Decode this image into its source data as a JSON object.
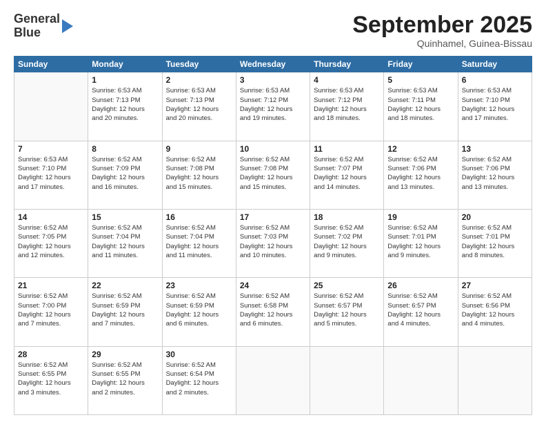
{
  "logo": {
    "line1": "General",
    "line2": "Blue"
  },
  "header": {
    "month": "September 2025",
    "location": "Quinhamel, Guinea-Bissau"
  },
  "days_of_week": [
    "Sunday",
    "Monday",
    "Tuesday",
    "Wednesday",
    "Thursday",
    "Friday",
    "Saturday"
  ],
  "weeks": [
    [
      {
        "day": "",
        "info": ""
      },
      {
        "day": "1",
        "info": "Sunrise: 6:53 AM\nSunset: 7:13 PM\nDaylight: 12 hours\nand 20 minutes."
      },
      {
        "day": "2",
        "info": "Sunrise: 6:53 AM\nSunset: 7:13 PM\nDaylight: 12 hours\nand 20 minutes."
      },
      {
        "day": "3",
        "info": "Sunrise: 6:53 AM\nSunset: 7:12 PM\nDaylight: 12 hours\nand 19 minutes."
      },
      {
        "day": "4",
        "info": "Sunrise: 6:53 AM\nSunset: 7:12 PM\nDaylight: 12 hours\nand 18 minutes."
      },
      {
        "day": "5",
        "info": "Sunrise: 6:53 AM\nSunset: 7:11 PM\nDaylight: 12 hours\nand 18 minutes."
      },
      {
        "day": "6",
        "info": "Sunrise: 6:53 AM\nSunset: 7:10 PM\nDaylight: 12 hours\nand 17 minutes."
      }
    ],
    [
      {
        "day": "7",
        "info": "Sunrise: 6:53 AM\nSunset: 7:10 PM\nDaylight: 12 hours\nand 17 minutes."
      },
      {
        "day": "8",
        "info": "Sunrise: 6:52 AM\nSunset: 7:09 PM\nDaylight: 12 hours\nand 16 minutes."
      },
      {
        "day": "9",
        "info": "Sunrise: 6:52 AM\nSunset: 7:08 PM\nDaylight: 12 hours\nand 15 minutes."
      },
      {
        "day": "10",
        "info": "Sunrise: 6:52 AM\nSunset: 7:08 PM\nDaylight: 12 hours\nand 15 minutes."
      },
      {
        "day": "11",
        "info": "Sunrise: 6:52 AM\nSunset: 7:07 PM\nDaylight: 12 hours\nand 14 minutes."
      },
      {
        "day": "12",
        "info": "Sunrise: 6:52 AM\nSunset: 7:06 PM\nDaylight: 12 hours\nand 13 minutes."
      },
      {
        "day": "13",
        "info": "Sunrise: 6:52 AM\nSunset: 7:06 PM\nDaylight: 12 hours\nand 13 minutes."
      }
    ],
    [
      {
        "day": "14",
        "info": "Sunrise: 6:52 AM\nSunset: 7:05 PM\nDaylight: 12 hours\nand 12 minutes."
      },
      {
        "day": "15",
        "info": "Sunrise: 6:52 AM\nSunset: 7:04 PM\nDaylight: 12 hours\nand 11 minutes."
      },
      {
        "day": "16",
        "info": "Sunrise: 6:52 AM\nSunset: 7:04 PM\nDaylight: 12 hours\nand 11 minutes."
      },
      {
        "day": "17",
        "info": "Sunrise: 6:52 AM\nSunset: 7:03 PM\nDaylight: 12 hours\nand 10 minutes."
      },
      {
        "day": "18",
        "info": "Sunrise: 6:52 AM\nSunset: 7:02 PM\nDaylight: 12 hours\nand 9 minutes."
      },
      {
        "day": "19",
        "info": "Sunrise: 6:52 AM\nSunset: 7:01 PM\nDaylight: 12 hours\nand 9 minutes."
      },
      {
        "day": "20",
        "info": "Sunrise: 6:52 AM\nSunset: 7:01 PM\nDaylight: 12 hours\nand 8 minutes."
      }
    ],
    [
      {
        "day": "21",
        "info": "Sunrise: 6:52 AM\nSunset: 7:00 PM\nDaylight: 12 hours\nand 7 minutes."
      },
      {
        "day": "22",
        "info": "Sunrise: 6:52 AM\nSunset: 6:59 PM\nDaylight: 12 hours\nand 7 minutes."
      },
      {
        "day": "23",
        "info": "Sunrise: 6:52 AM\nSunset: 6:59 PM\nDaylight: 12 hours\nand 6 minutes."
      },
      {
        "day": "24",
        "info": "Sunrise: 6:52 AM\nSunset: 6:58 PM\nDaylight: 12 hours\nand 6 minutes."
      },
      {
        "day": "25",
        "info": "Sunrise: 6:52 AM\nSunset: 6:57 PM\nDaylight: 12 hours\nand 5 minutes."
      },
      {
        "day": "26",
        "info": "Sunrise: 6:52 AM\nSunset: 6:57 PM\nDaylight: 12 hours\nand 4 minutes."
      },
      {
        "day": "27",
        "info": "Sunrise: 6:52 AM\nSunset: 6:56 PM\nDaylight: 12 hours\nand 4 minutes."
      }
    ],
    [
      {
        "day": "28",
        "info": "Sunrise: 6:52 AM\nSunset: 6:55 PM\nDaylight: 12 hours\nand 3 minutes."
      },
      {
        "day": "29",
        "info": "Sunrise: 6:52 AM\nSunset: 6:55 PM\nDaylight: 12 hours\nand 2 minutes."
      },
      {
        "day": "30",
        "info": "Sunrise: 6:52 AM\nSunset: 6:54 PM\nDaylight: 12 hours\nand 2 minutes."
      },
      {
        "day": "",
        "info": ""
      },
      {
        "day": "",
        "info": ""
      },
      {
        "day": "",
        "info": ""
      },
      {
        "day": "",
        "info": ""
      }
    ]
  ]
}
